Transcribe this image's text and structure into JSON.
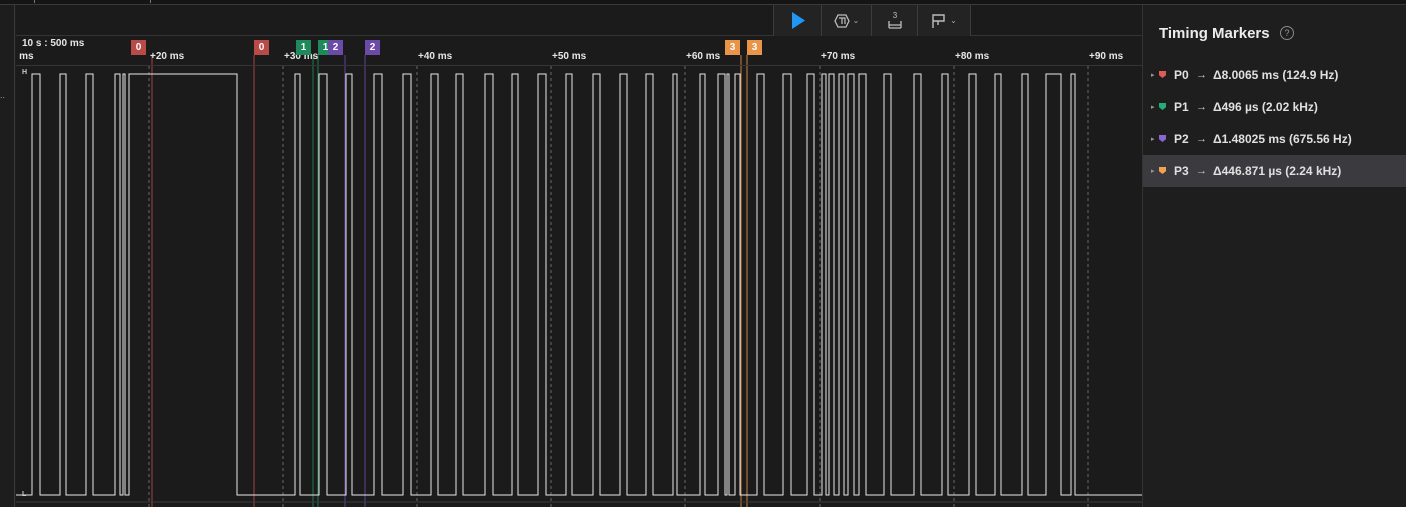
{
  "theme": {
    "high_colors": {
      "P0": "#c8554e",
      "P1": "#1c9e6c",
      "P2": "#7d5cc0",
      "P3": "#f0a050"
    },
    "play_color": "#2196f3"
  },
  "toolbar": {
    "play_icon": "play-icon",
    "trigger_icon": "trigger-icon",
    "measure_icon": "measure-icon",
    "marker_icon": "marker-flag-icon",
    "measure_digit": "3"
  },
  "timeline": {
    "scale_label": "10 s : 500 ms",
    "start_fragment": ") ms",
    "ticks": [
      "+20 ms",
      "+30 ms",
      "+40 ms",
      "+50 ms",
      "+60 ms",
      "+70 ms",
      "+80 ms",
      "+90 ms"
    ],
    "level_high": "H",
    "level_low": "L",
    "gutter_text": ".."
  },
  "markers": [
    {
      "label": "0",
      "color": "#b84a47"
    },
    {
      "label": "0",
      "color": "#b84a47"
    },
    {
      "label": "1",
      "color": "#1e8a5c"
    },
    {
      "label": "1",
      "color": "#1e8a5c"
    },
    {
      "label": "2",
      "color": "#6b4aa8"
    },
    {
      "label": "2",
      "color": "#6b4aa8"
    },
    {
      "label": "3",
      "color": "#e8954a"
    },
    {
      "label": "3",
      "color": "#e8954a"
    }
  ],
  "panel": {
    "title": "Timing Markers",
    "help_icon": "help-circle-icon",
    "rows": [
      {
        "name": "P0",
        "arrow": "→",
        "value": "Δ8.0065 ms (124.9 Hz)",
        "color": "#e05b55",
        "selected": false
      },
      {
        "name": "P1",
        "arrow": "→",
        "value": "Δ496 µs (2.02 kHz)",
        "color": "#22b07a",
        "selected": false
      },
      {
        "name": "P2",
        "arrow": "→",
        "value": "Δ1.48025 ms (675.56 Hz)",
        "color": "#8a66d4",
        "selected": false
      },
      {
        "name": "P3",
        "arrow": "→",
        "value": "Δ446.871 µs (2.24 kHz)",
        "color": "#f5a04f",
        "selected": true
      }
    ]
  }
}
